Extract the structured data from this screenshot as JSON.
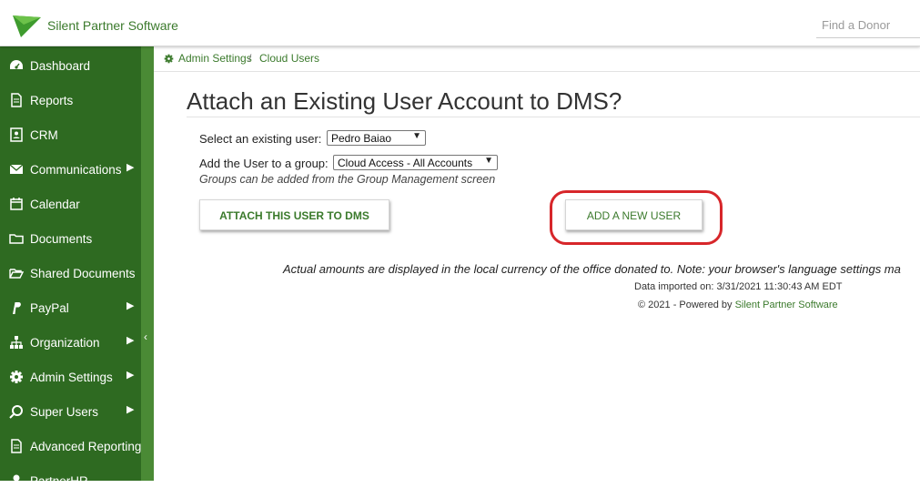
{
  "header": {
    "brand": "Silent Partner Software",
    "search_placeholder": "Find a Donor"
  },
  "sidebar": {
    "items": [
      {
        "label": "Dashboard",
        "icon": "dashboard-icon",
        "has_submenu": false
      },
      {
        "label": "Reports",
        "icon": "report-icon",
        "has_submenu": false
      },
      {
        "label": "CRM",
        "icon": "address-card-icon",
        "has_submenu": false
      },
      {
        "label": "Communications",
        "icon": "envelope-icon",
        "has_submenu": true
      },
      {
        "label": "Calendar",
        "icon": "calendar-icon",
        "has_submenu": false
      },
      {
        "label": "Documents",
        "icon": "folder-icon",
        "has_submenu": false
      },
      {
        "label": "Shared Documents",
        "icon": "folder-open-icon",
        "has_submenu": false
      },
      {
        "label": "PayPal",
        "icon": "paypal-icon",
        "has_submenu": true
      },
      {
        "label": "Organization",
        "icon": "sitemap-icon",
        "has_submenu": true
      },
      {
        "label": "Admin Settings",
        "icon": "gear-icon",
        "has_submenu": true
      },
      {
        "label": "Super Users",
        "icon": "ring-icon",
        "has_submenu": true
      },
      {
        "label": "Advanced Reporting",
        "icon": "report-icon",
        "has_submenu": false
      },
      {
        "label": "PartnerHR",
        "icon": "user-icon",
        "has_submenu": false
      }
    ]
  },
  "breadcrumb": {
    "items": [
      "Admin Settings",
      "Cloud Users"
    ],
    "separator": "/"
  },
  "main": {
    "title": "Attach an Existing User Account to DMS?",
    "select_user_label": "Select an existing user:",
    "select_user_value": "Pedro Baiao",
    "group_label": "Add the User to a group:",
    "group_value": "Cloud Access - All Accounts",
    "group_hint": "Groups can be added from the Group Management screen",
    "attach_button": "ATTACH THIS USER TO DMS",
    "add_new_button": "ADD A NEW USER"
  },
  "footer": {
    "currency_note": "Actual amounts are displayed in the local currency of the office donated to. Note: your browser's language settings ma",
    "data_imported": "Data imported on: 3/31/2021 11:30:43 AM EDT",
    "copyright_prefix": "© 2021 - Powered by ",
    "copyright_link": "Silent Partner Software"
  },
  "colors": {
    "sidebar_bg": "#2e6a21",
    "accent_green": "#3b7a2c",
    "highlight_red": "#d7262a"
  }
}
